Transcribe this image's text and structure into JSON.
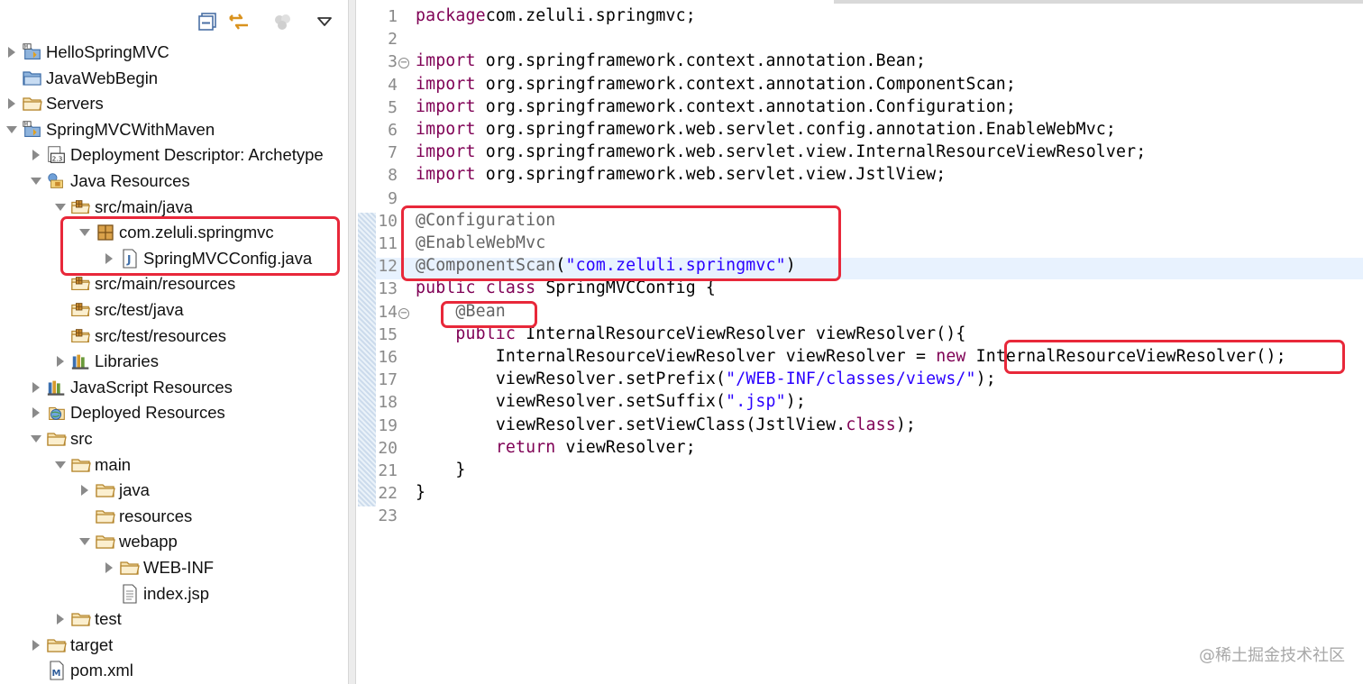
{
  "explorer": {
    "toolbar": [
      "collapse-all-icon",
      "link-with-editor-icon",
      "filters-icon",
      "view-menu-icon"
    ],
    "tree": [
      {
        "label": "HelloSpringMVC",
        "icon": "web-project-icon",
        "level": 0,
        "twisty": "collapsed"
      },
      {
        "label": "JavaWebBegin",
        "icon": "project-folder-icon",
        "level": 0,
        "twisty": "none"
      },
      {
        "label": "Servers",
        "icon": "folder-icon",
        "level": 0,
        "twisty": "collapsed"
      },
      {
        "label": "SpringMVCWithMaven",
        "icon": "web-project-icon",
        "level": 0,
        "twisty": "expanded"
      },
      {
        "label": "Deployment Descriptor: Archetype",
        "icon": "deployment-descriptor-icon",
        "level": 1,
        "twisty": "collapsed"
      },
      {
        "label": "Java Resources",
        "icon": "java-resources-icon",
        "level": 1,
        "twisty": "expanded"
      },
      {
        "label": "src/main/java",
        "icon": "source-folder-icon",
        "level": 2,
        "twisty": "expanded"
      },
      {
        "label": "com.zeluli.springmvc",
        "icon": "package-icon",
        "level": 3,
        "twisty": "expanded"
      },
      {
        "label": "SpringMVCConfig.java",
        "icon": "java-file-icon",
        "level": 4,
        "twisty": "collapsed"
      },
      {
        "label": "src/main/resources",
        "icon": "source-folder-icon",
        "level": 2,
        "twisty": "none"
      },
      {
        "label": "src/test/java",
        "icon": "source-folder-icon",
        "level": 2,
        "twisty": "none"
      },
      {
        "label": "src/test/resources",
        "icon": "source-folder-icon",
        "level": 2,
        "twisty": "none"
      },
      {
        "label": "Libraries",
        "icon": "libraries-icon",
        "level": 2,
        "twisty": "collapsed"
      },
      {
        "label": "JavaScript Resources",
        "icon": "libraries-icon",
        "level": 1,
        "twisty": "collapsed"
      },
      {
        "label": "Deployed Resources",
        "icon": "deployed-resources-icon",
        "level": 1,
        "twisty": "collapsed"
      },
      {
        "label": "src",
        "icon": "folder-icon",
        "level": 1,
        "twisty": "expanded"
      },
      {
        "label": "main",
        "icon": "folder-icon",
        "level": 2,
        "twisty": "expanded"
      },
      {
        "label": "java",
        "icon": "folder-icon",
        "level": 3,
        "twisty": "collapsed"
      },
      {
        "label": "resources",
        "icon": "folder-icon",
        "level": 3,
        "twisty": "none"
      },
      {
        "label": "webapp",
        "icon": "folder-icon",
        "level": 3,
        "twisty": "expanded"
      },
      {
        "label": "WEB-INF",
        "icon": "folder-icon",
        "level": 4,
        "twisty": "collapsed"
      },
      {
        "label": "index.jsp",
        "icon": "jsp-file-icon",
        "level": 4,
        "twisty": "none"
      },
      {
        "label": "test",
        "icon": "folder-icon",
        "level": 2,
        "twisty": "collapsed"
      },
      {
        "label": "target",
        "icon": "folder-icon",
        "level": 1,
        "twisty": "collapsed"
      },
      {
        "label": "pom.xml",
        "icon": "maven-file-icon",
        "level": 1,
        "twisty": "none"
      }
    ]
  },
  "editor": {
    "lines": [
      {
        "n": "1",
        "t": [
          [
            "kw",
            "package"
          ],
          [
            "",
            "com.zeluli.springmvc;"
          ]
        ]
      },
      {
        "n": "2",
        "t": []
      },
      {
        "n": "3",
        "fold": true,
        "t": [
          [
            "kw",
            "import"
          ],
          [
            "",
            " org.springframework.context.annotation.Bean;"
          ]
        ]
      },
      {
        "n": "4",
        "t": [
          [
            "kw",
            "import"
          ],
          [
            "",
            " org.springframework.context.annotation.ComponentScan;"
          ]
        ]
      },
      {
        "n": "5",
        "t": [
          [
            "kw",
            "import"
          ],
          [
            "",
            " org.springframework.context.annotation.Configuration;"
          ]
        ]
      },
      {
        "n": "6",
        "t": [
          [
            "kw",
            "import"
          ],
          [
            "",
            " org.springframework.web.servlet.config.annotation.EnableWebMvc;"
          ]
        ]
      },
      {
        "n": "7",
        "t": [
          [
            "kw",
            "import"
          ],
          [
            "",
            " org.springframework.web.servlet.view.InternalResourceViewResolver;"
          ]
        ]
      },
      {
        "n": "8",
        "t": [
          [
            "kw",
            "import"
          ],
          [
            "",
            " org.springframework.web.servlet.view.JstlView;"
          ]
        ]
      },
      {
        "n": "9",
        "t": []
      },
      {
        "n": "10",
        "t": [
          [
            "an",
            "@Configuration"
          ]
        ]
      },
      {
        "n": "11",
        "t": [
          [
            "an",
            "@EnableWebMvc"
          ]
        ]
      },
      {
        "n": "12",
        "t": [
          [
            "an",
            "@ComponentScan"
          ],
          [
            "",
            "("
          ],
          [
            "str",
            "\"com.zeluli.springmvc\""
          ],
          [
            "",
            ")"
          ]
        ]
      },
      {
        "n": "13",
        "t": [
          [
            "kw",
            "public"
          ],
          [
            "",
            " "
          ],
          [
            "kw",
            "class"
          ],
          [
            "",
            " SpringMVCConfig {"
          ]
        ]
      },
      {
        "n": "14",
        "fold": true,
        "t": [
          [
            "",
            "    "
          ],
          [
            "an",
            "@Bean"
          ]
        ]
      },
      {
        "n": "15",
        "t": [
          [
            "",
            "    "
          ],
          [
            "kw",
            "public"
          ],
          [
            "",
            " InternalResourceViewResolver viewResolver(){"
          ]
        ]
      },
      {
        "n": "16",
        "t": [
          [
            "",
            "        InternalResourceViewResolver "
          ],
          [
            "",
            "viewResolver"
          ],
          [
            "",
            " = "
          ],
          [
            "kw",
            "new"
          ],
          [
            "",
            " InternalResourceViewResolver();"
          ]
        ]
      },
      {
        "n": "17",
        "t": [
          [
            "",
            "        "
          ],
          [
            "",
            "viewResolver"
          ],
          [
            "",
            ".setPrefix("
          ],
          [
            "str",
            "\"/WEB-INF/classes/views/\""
          ],
          [
            "",
            ");"
          ]
        ]
      },
      {
        "n": "18",
        "t": [
          [
            "",
            "        "
          ],
          [
            "",
            "viewResolver"
          ],
          [
            "",
            ".setSuffix("
          ],
          [
            "str",
            "\".jsp\""
          ],
          [
            "",
            ");"
          ]
        ]
      },
      {
        "n": "19",
        "t": [
          [
            "",
            "        "
          ],
          [
            "",
            "viewResolver"
          ],
          [
            "",
            ".setViewClass(JstlView."
          ],
          [
            "kw",
            "class"
          ],
          [
            "",
            ");"
          ]
        ]
      },
      {
        "n": "20",
        "t": [
          [
            "",
            "        "
          ],
          [
            "kw",
            "return"
          ],
          [
            "",
            " "
          ],
          [
            "",
            "viewResolver"
          ],
          [
            "",
            ";"
          ]
        ]
      },
      {
        "n": "21",
        "t": [
          [
            "",
            "    }"
          ]
        ]
      },
      {
        "n": "22",
        "t": [
          [
            "",
            "}"
          ]
        ]
      },
      {
        "n": "23",
        "t": []
      }
    ]
  },
  "watermark": "@稀土掘金技术社区",
  "colors": {
    "keyword": "#7f0055",
    "annotation": "#646464",
    "string": "#2a00ff",
    "highlight_box": "#e8283a",
    "current_line": "#e8f2fe"
  }
}
